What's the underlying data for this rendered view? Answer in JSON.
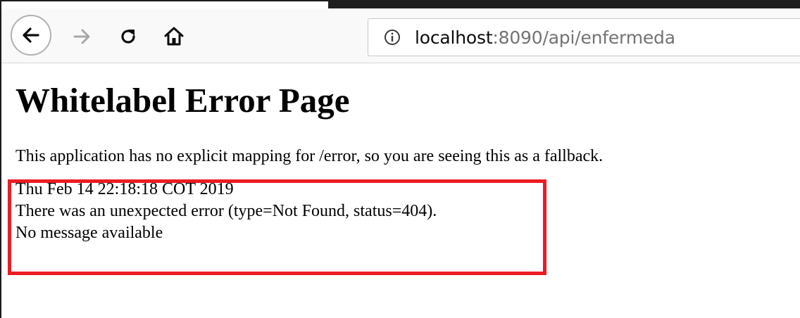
{
  "browser": {
    "url_host": "localhost",
    "url_rest": ":8090/api/enfermeda",
    "icons": {
      "back": "back-arrow-icon",
      "forward": "forward-arrow-icon",
      "reload": "reload-icon",
      "home": "home-icon",
      "info": "info-icon"
    }
  },
  "page": {
    "title": "Whitelabel Error Page",
    "message": "This application has no explicit mapping for /error, so you are seeing this as a fallback.",
    "timestamp": "Thu Feb 14 22:18:18 COT 2019",
    "error_line": "There was an unexpected error (type=Not Found, status=404).",
    "detail": "No message available"
  },
  "colors": {
    "highlight_border": "#ec1c24",
    "url_host": "#0c0c0d",
    "url_rest": "#737373"
  }
}
